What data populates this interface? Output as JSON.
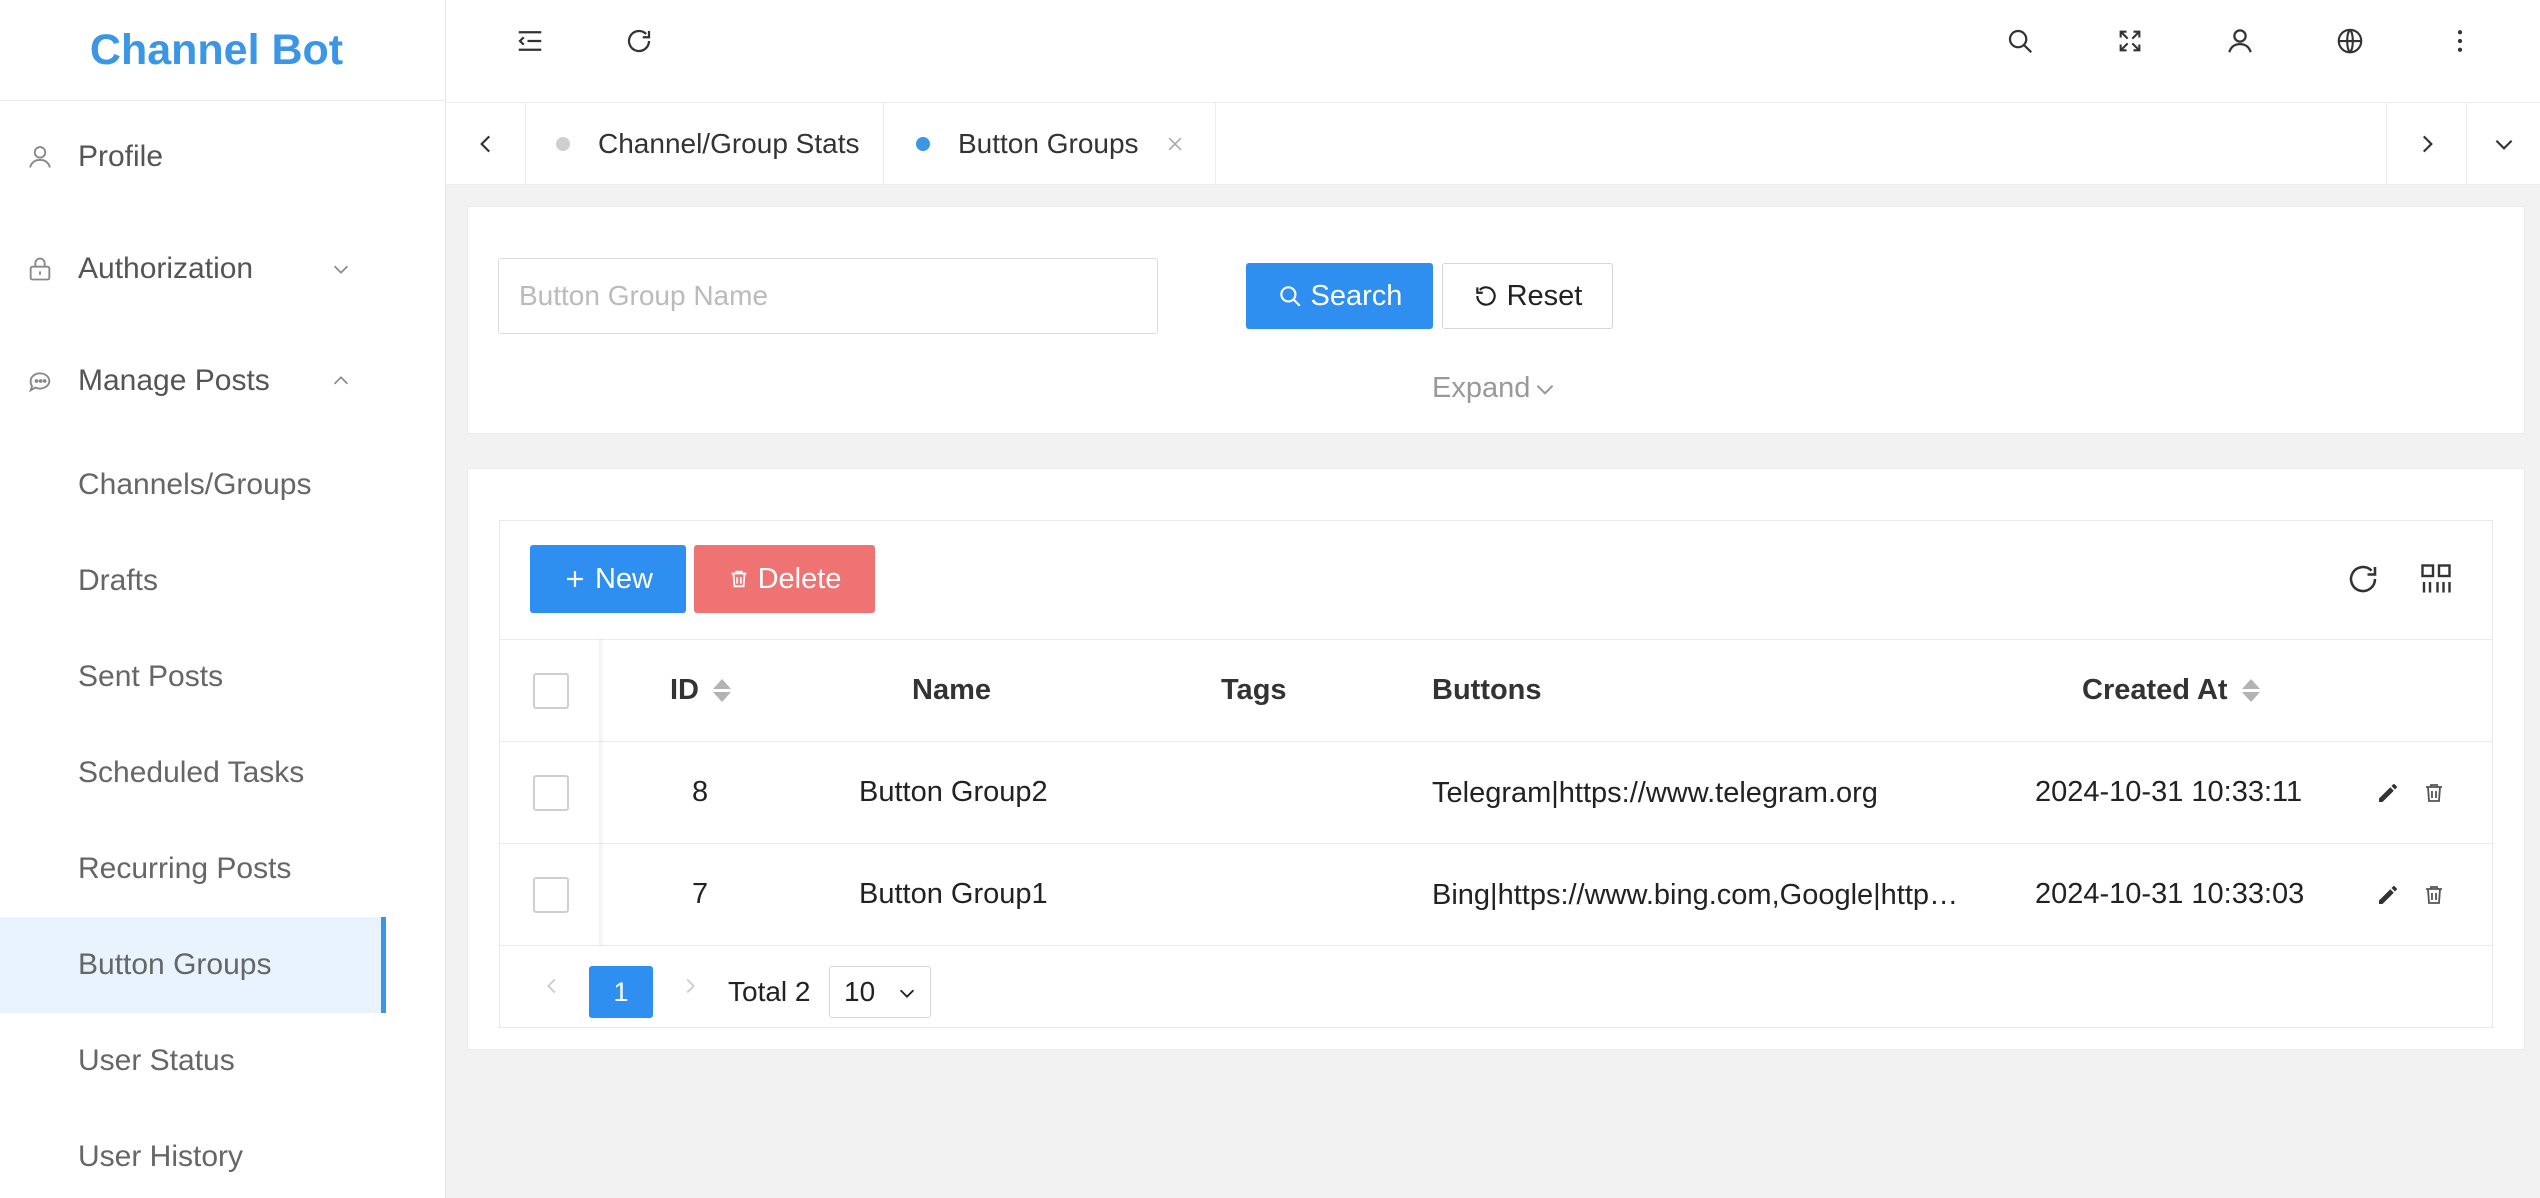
{
  "app": {
    "title": "Channel Bot"
  },
  "sidebar": {
    "items": [
      {
        "label": "Profile",
        "icon": "user-icon"
      },
      {
        "label": "Authorization",
        "icon": "lock-icon",
        "chevron": "down"
      },
      {
        "label": "Manage Posts",
        "icon": "chat-icon",
        "chevron": "up"
      },
      {
        "label": "Channels/Groups"
      },
      {
        "label": "Drafts"
      },
      {
        "label": "Sent Posts"
      },
      {
        "label": "Scheduled Tasks"
      },
      {
        "label": "Recurring Posts"
      },
      {
        "label": "Button Groups",
        "active": true
      },
      {
        "label": "User Status"
      },
      {
        "label": "User History"
      }
    ]
  },
  "topbar": {
    "icons": [
      "menu-collapse-icon",
      "refresh-icon",
      "search-icon",
      "fullscreen-icon",
      "user-icon",
      "globe-icon",
      "more-icon"
    ]
  },
  "tabs": [
    {
      "label": "Channel/Group Stats",
      "active": false
    },
    {
      "label": "Button Groups",
      "active": true,
      "closable": true
    }
  ],
  "search": {
    "placeholder": "Button Group Name",
    "search_label": "Search",
    "reset_label": "Reset",
    "expand_label": "Expand"
  },
  "toolbar": {
    "new_label": "New",
    "delete_label": "Delete"
  },
  "table": {
    "columns": [
      "ID",
      "Name",
      "Tags",
      "Buttons",
      "Created At"
    ],
    "rows": [
      {
        "id": "8",
        "name": "Button Group2",
        "tags": "",
        "buttons": "Telegram|https://www.telegram.org",
        "created_at": "2024-10-31 10:33:11"
      },
      {
        "id": "7",
        "name": "Button Group1",
        "tags": "",
        "buttons": "Bing|https://www.bing.com,Google|https://www.google.com",
        "created_at": "2024-10-31 10:33:03"
      }
    ]
  },
  "pagination": {
    "current_page": "1",
    "total_label": "Total 2",
    "page_size": "10"
  },
  "colors": {
    "accent": "#3c96e6",
    "primary_button": "#2e8ff0",
    "danger_button": "#f07373",
    "active_nav_bg": "#e8f3fd"
  }
}
